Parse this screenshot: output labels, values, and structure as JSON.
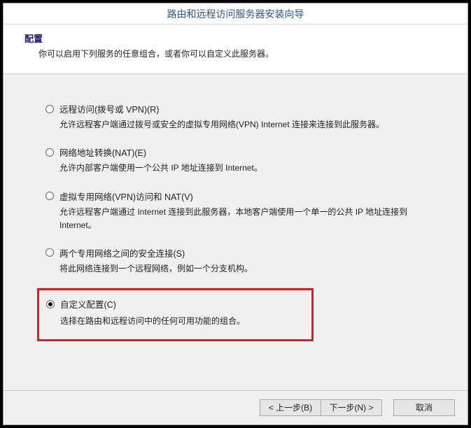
{
  "titlebar": "路由和远程访问服务器安装向导",
  "header": {
    "title": "配置",
    "desc": "你可以启用下列服务的任意组合，或者你可以自定义此服务器。"
  },
  "options": [
    {
      "label": "远程访问(拨号或 VPN)(R)",
      "desc": "允许远程客户端通过拨号或安全的虚拟专用网络(VPN) Internet 连接来连接到此服务器。",
      "selected": false
    },
    {
      "label": "网络地址转换(NAT)(E)",
      "desc": "允许内部客户端使用一个公共 IP 地址连接到 Internet。",
      "selected": false
    },
    {
      "label": "虚拟专用网络(VPN)访问和 NAT(V)",
      "desc": "允许远程客户端通过 Internet 连接到此服务器，本地客户端使用一个单一的公共 IP 地址连接到 Internet。",
      "selected": false
    },
    {
      "label": "两个专用网络之间的安全连接(S)",
      "desc": "将此网络连接到一个远程网络，例如一个分支机构。",
      "selected": false
    },
    {
      "label": "自定义配置(C)",
      "desc": "选择在路由和远程访问中的任何可用功能的组合。",
      "selected": true
    }
  ],
  "buttons": {
    "back": "< 上一步(B)",
    "next": "下一步(N) >",
    "cancel": "取消"
  }
}
